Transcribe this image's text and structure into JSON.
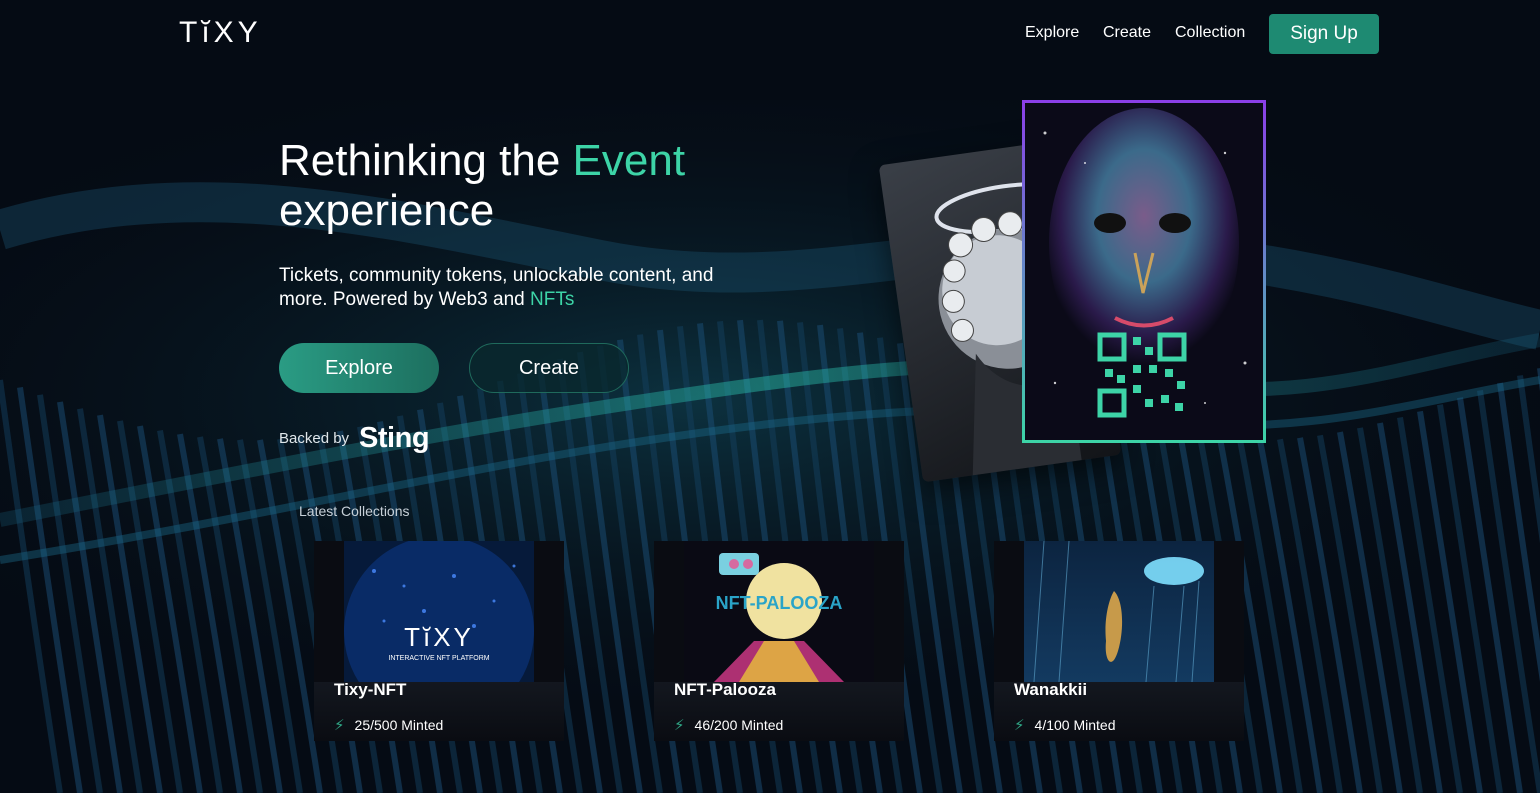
{
  "nav": {
    "logo": "TĭXY",
    "links": [
      "Explore",
      "Create",
      "Collection"
    ],
    "signup": "Sign Up"
  },
  "hero": {
    "title_part1": "Rethinking the ",
    "title_accent": "Event",
    "title_part2": "experience",
    "sub_part1": "Tickets, community tokens, unlockable content, and more. Powered by Web3 and ",
    "sub_accent": "NFTs",
    "explore_btn": "Explore",
    "create_btn": "Create",
    "backed_label": "Backed by",
    "backed_brand": "Sting"
  },
  "latest": {
    "heading": "Latest Collections",
    "cards": [
      {
        "title": "Tixy-NFT",
        "minted": "25/500 Minted",
        "art_text": "TĭXY",
        "art_sub": "INTERACTIVE NFT PLATFORM"
      },
      {
        "title": "NFT-Palooza",
        "minted": "46/200 Minted",
        "art_text": "NFT-PALOOZA"
      },
      {
        "title": "Wanakkii",
        "minted": "4/100 Minted"
      }
    ]
  },
  "colors": {
    "accent": "#3dd4a7",
    "button": "#1e8a72",
    "background": "#050b14"
  },
  "icons": {
    "minted": "lightning-bolt-icon"
  }
}
